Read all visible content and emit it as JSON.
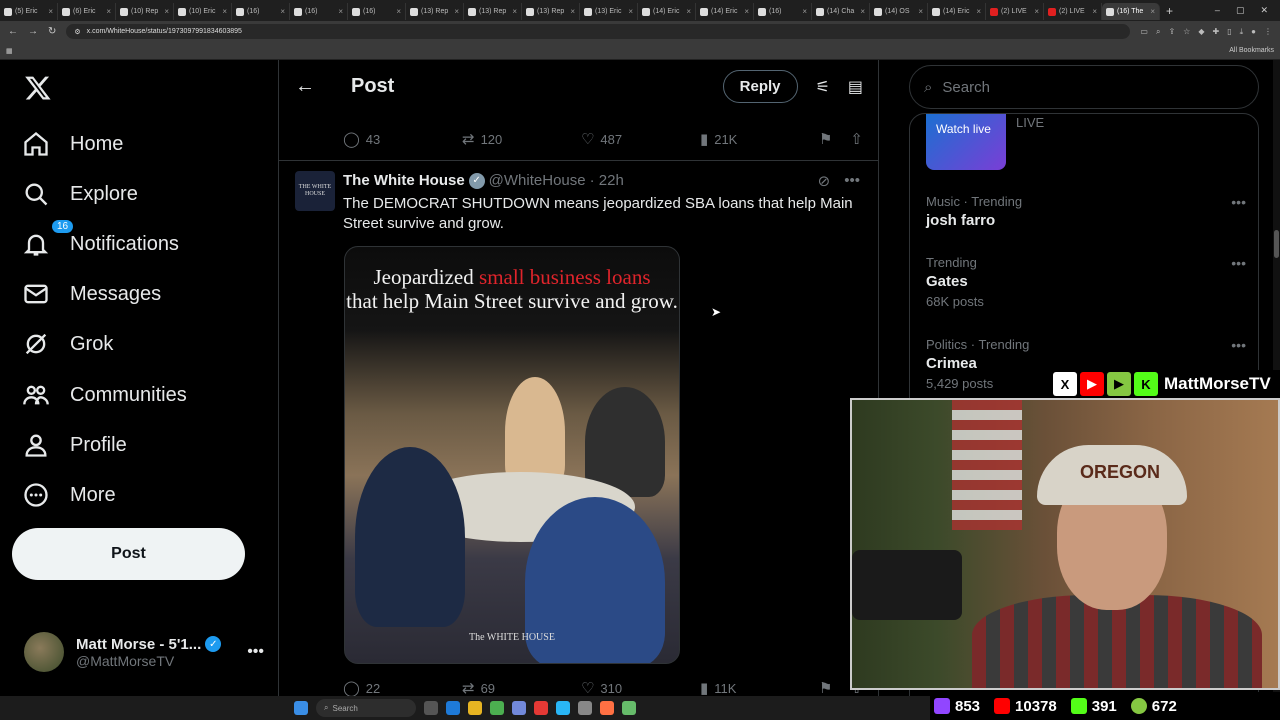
{
  "browser": {
    "tabs": [
      {
        "label": "(5) Eric",
        "icon": "x-icon"
      },
      {
        "label": "(6) Eric",
        "icon": "x-icon"
      },
      {
        "label": "(10) Rep",
        "icon": "x-icon"
      },
      {
        "label": "(10) Eric",
        "icon": "x-icon"
      },
      {
        "label": "(16)",
        "icon": "x-icon"
      },
      {
        "label": "(16)",
        "icon": "x-icon"
      },
      {
        "label": "(16)",
        "icon": "x-icon"
      },
      {
        "label": "(13) Rep",
        "icon": "x-icon"
      },
      {
        "label": "(13) Rep",
        "icon": "x-icon"
      },
      {
        "label": "(13) Rep",
        "icon": "x-icon"
      },
      {
        "label": "(13) Eric",
        "icon": "x-icon"
      },
      {
        "label": "(14) Eric",
        "icon": "x-icon"
      },
      {
        "label": "(14) Eric",
        "icon": "x-icon"
      },
      {
        "label": "(16)",
        "icon": "x-icon"
      },
      {
        "label": "(14) Cha",
        "icon": "x-icon"
      },
      {
        "label": "(14) OS",
        "icon": "x-icon"
      },
      {
        "label": "(14) Eric",
        "icon": "x-icon"
      },
      {
        "label": "(2) LIVE",
        "icon": "youtube-icon"
      },
      {
        "label": "(2) LIVE",
        "icon": "youtube-icon"
      },
      {
        "label": "(16) The",
        "icon": "x-icon",
        "active": true
      }
    ],
    "url": "x.com/WhiteHouse/status/1973097991834603895",
    "all_bookmarks": "All Bookmarks"
  },
  "nav": {
    "items": [
      {
        "label": "Home",
        "icon": "home-icon"
      },
      {
        "label": "Explore",
        "icon": "search-icon"
      },
      {
        "label": "Notifications",
        "icon": "bell-icon",
        "badge": "16"
      },
      {
        "label": "Messages",
        "icon": "mail-icon"
      },
      {
        "label": "Grok",
        "icon": "grok-icon"
      },
      {
        "label": "Communities",
        "icon": "communities-icon"
      },
      {
        "label": "Profile",
        "icon": "person-icon"
      },
      {
        "label": "More",
        "icon": "more-circle-icon"
      }
    ],
    "post_label": "Post",
    "account": {
      "name": "Matt Morse - 5'1...",
      "handle": "@MattMorseTV"
    }
  },
  "main": {
    "header_title": "Post",
    "reply_label": "Reply",
    "prev_actions": {
      "replies": "43",
      "reposts": "120",
      "likes": "487",
      "views": "21K"
    },
    "tweet": {
      "name": "The White House",
      "handle": "@WhiteHouse",
      "time": "· 22h",
      "avatar_text": "THE WHITE HOUSE",
      "text": "The DEMOCRAT SHUTDOWN means jeopardized SBA loans that help Main Street survive and grow.",
      "image_headline_1": "Jeopardized ",
      "image_headline_red": "small business loans",
      "image_headline_2": "that help Main Street survive and grow.",
      "image_watermark": "The WHITE HOUSE",
      "actions": {
        "replies": "22",
        "reposts": "69",
        "likes": "310",
        "views": "11K"
      }
    }
  },
  "right": {
    "search_placeholder": "Search",
    "live": {
      "thumb_text": "Watch live",
      "label": "LIVE"
    },
    "trends": [
      {
        "context": "Music · Trending",
        "topic": "josh farro",
        "count": ""
      },
      {
        "context": "Trending",
        "topic": "Gates",
        "count": "68K posts"
      },
      {
        "context": "Politics · Trending",
        "topic": "Crimea",
        "count": "5,429 posts"
      }
    ]
  },
  "overlay": {
    "channel_name": "MattMorseTV",
    "stats": {
      "twitch": "853",
      "youtube": "10378",
      "kick": "391",
      "rumble": "672"
    },
    "hat_text": "OREGON"
  },
  "taskbar": {
    "search_label": "Search"
  },
  "colors": {
    "accent": "#1d9bf0",
    "background": "#000000",
    "border": "#2f3336",
    "muted": "#71767b",
    "headline_red": "#e0242b"
  }
}
